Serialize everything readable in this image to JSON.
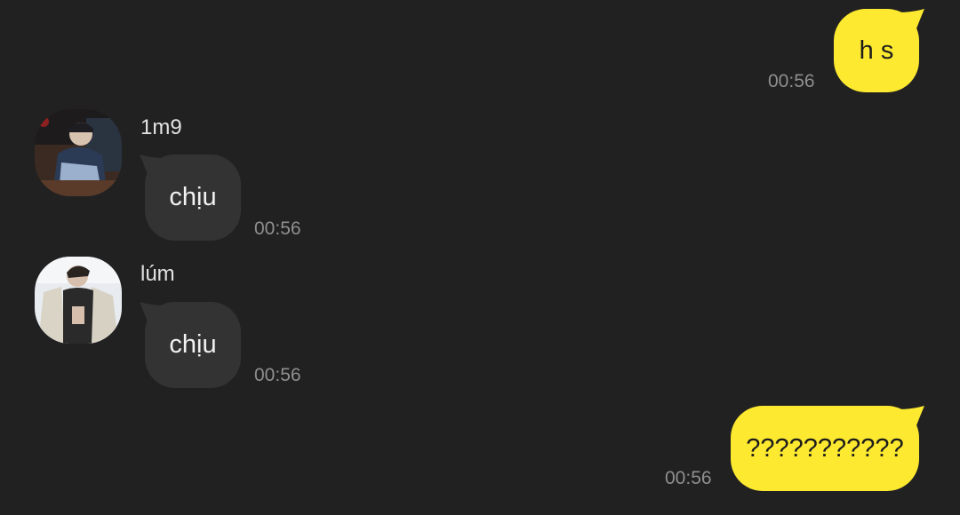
{
  "colors": {
    "background": "#212121",
    "outgoing_bubble": "#fde92f",
    "incoming_bubble": "#333333",
    "timestamp": "#8f8f8f",
    "sender_name": "#e2e2e2"
  },
  "messages": [
    {
      "direction": "outgoing",
      "text": "h s",
      "time": "00:56"
    },
    {
      "direction": "incoming",
      "sender": "1m9",
      "avatar": "avatar-photo-dark",
      "text": "chịu",
      "time": "00:56"
    },
    {
      "direction": "incoming",
      "sender": "lúm",
      "avatar": "avatar-photo-light",
      "text": "chịu",
      "time": "00:56"
    },
    {
      "direction": "outgoing",
      "text": "???????????",
      "time": "00:56"
    }
  ]
}
